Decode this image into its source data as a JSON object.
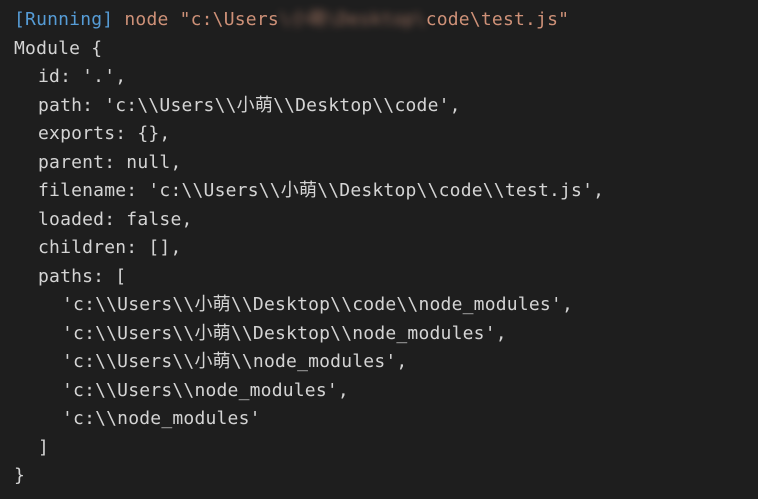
{
  "run_header": {
    "status": "[Running]",
    "command_prefix": " node \"c:\\Users",
    "redacted_segment": "\\小萌\\Desktop\\",
    "command_suffix": "code\\test.js\""
  },
  "output": {
    "open": "Module {",
    "lines": [
      "id: '.',",
      "path: 'c:\\\\Users\\\\小萌\\\\Desktop\\\\code',",
      "exports: {},",
      "parent: null,",
      "filename: 'c:\\\\Users\\\\小萌\\\\Desktop\\\\code\\\\test.js',",
      "loaded: false,",
      "children: [],",
      "paths: ["
    ],
    "paths": [
      "'c:\\\\Users\\\\小萌\\\\Desktop\\\\code\\\\node_modules',",
      "'c:\\\\Users\\\\小萌\\\\Desktop\\\\node_modules',",
      "'c:\\\\Users\\\\小萌\\\\node_modules',",
      "'c:\\\\Users\\\\node_modules',",
      "'c:\\\\node_modules'"
    ],
    "paths_close": "]",
    "close": "}"
  },
  "colors": {
    "background": "#1e1e1e",
    "text": "#d4d4d4",
    "running": "#569cd6",
    "command": "#ce9178"
  }
}
